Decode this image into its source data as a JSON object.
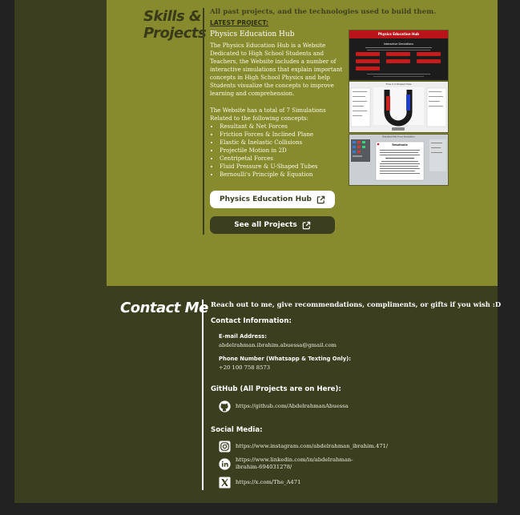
{
  "skills": {
    "title_line1": "Skills &",
    "title_line2": "Projects",
    "intro": "All past projects, and the technologies used to build them.",
    "latest_label": "LATEST PROJECT:",
    "project_name": "Physics Education Hub",
    "description": "The Physics Education Hub is a Website Dedicated to High School Students and Teachers, the Website includes a number of interactive simulations that explain important concepts in High School Physics and help Students visualize the concepts to improve learning and comprehension.",
    "summary": "The Website has a total of 7 Simulations Related to the following concepts:",
    "concepts": [
      "Resultant & Net Forces",
      "Friction Forces & Inclined Plane",
      "Elastic & Inelastic Collisions",
      "Projectile Motion in 2D",
      "Centripetal Forces",
      "Fluid Pressure & U-Shaped Tubes",
      "Bernoulli's Principle & Equation"
    ],
    "hub_button": "Physics Education Hub",
    "all_button": "See all Projects",
    "screenshot_titles": [
      "Physics Education Hub",
      "Interactive Simulations",
      "Flow in U-Shaped Tube",
      "Resultant Net Force Simulation",
      "Resultants"
    ]
  },
  "contact": {
    "title": "Contact Me",
    "reach": "Reach out to me, give recommendations, compliments, or gifts if you wish :D",
    "info_heading": "Contact Information:",
    "email_label": "E-mail Address:",
    "email": "abdelrahman.ibrahim.abuessa@gmail.com",
    "phone_label": "Phone Number (Whatsapp & Texting Only):",
    "phone": "+20 100 758 8573",
    "github_heading": "GitHub (All Projects are on Here):",
    "github_url": "https://github.com/AbdelrahmanAbuessa",
    "social_heading": "Social Media:",
    "instagram_url": "https://www.instagram.com/abdelrahman_ibrahim.471/",
    "linkedin_url_line1": "https://www.linkedin.com/in/abdelrahman-",
    "linkedin_url_line2": "ibrahim-694031278/",
    "x_url": "https://x.com/The_A471"
  },
  "icons": [
    "external-link-icon",
    "github-icon",
    "instagram-icon",
    "linkedin-icon",
    "x-icon"
  ],
  "colors": {
    "page_bg": "#222222",
    "dark_olive": "#3b3e1f",
    "olive": "#878a2d",
    "red": "#b8141a"
  }
}
